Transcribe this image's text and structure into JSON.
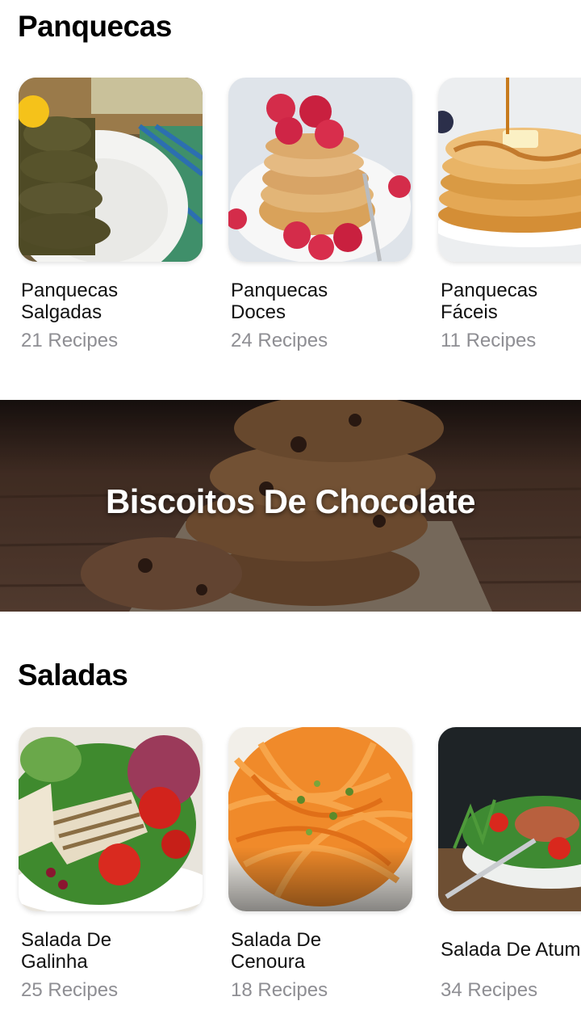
{
  "sections": [
    {
      "title": "Panquecas",
      "cards": [
        {
          "title": "Panquecas\nSalgadas",
          "count": "21 Recipes"
        },
        {
          "title": "Panquecas\nDoces",
          "count": "24 Recipes"
        },
        {
          "title": "Panquecas\nFáceis",
          "count": "11 Recipes"
        }
      ]
    },
    {
      "title": "Saladas",
      "cards": [
        {
          "title": "Salada De\nGalinha",
          "count": "25 Recipes"
        },
        {
          "title": "Salada De\nCenoura",
          "count": "18 Recipes"
        },
        {
          "title": "Salada De Atum",
          "count": "34 Recipes"
        }
      ]
    }
  ],
  "banner": {
    "title": "Biscoitos De Chocolate"
  }
}
